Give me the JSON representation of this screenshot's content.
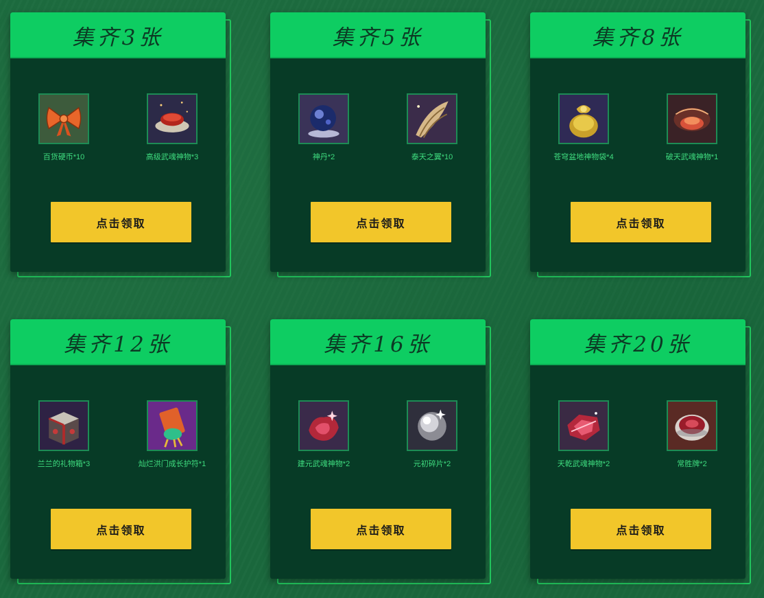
{
  "button_label": "点击领取",
  "cards": [
    {
      "title": "集齐3张",
      "rewards": [
        {
          "label": "百货硬币*10",
          "icon": "bow-icon"
        },
        {
          "label": "高级武魂神物*3",
          "icon": "artifact-plate-icon"
        }
      ]
    },
    {
      "title": "集齐5张",
      "rewards": [
        {
          "label": "神丹*2",
          "icon": "pill-orb-icon"
        },
        {
          "label": "泰天之翼*10",
          "icon": "wing-icon"
        }
      ]
    },
    {
      "title": "集齐8张",
      "rewards": [
        {
          "label": "苍穹盆地神物袋*4",
          "icon": "gold-bag-icon"
        },
        {
          "label": "破天武魂神物*1",
          "icon": "fire-artifact-icon"
        }
      ]
    },
    {
      "title": "集齐12张",
      "rewards": [
        {
          "label": "兰兰的礼物箱*3",
          "icon": "gift-box-icon"
        },
        {
          "label": "灿烂洪门成长护符*1",
          "icon": "amulet-icon"
        }
      ]
    },
    {
      "title": "集齐16张",
      "rewards": [
        {
          "label": "建元武魂神物*2",
          "icon": "red-crystal-icon"
        },
        {
          "label": "元初碎片*2",
          "icon": "silver-orb-icon"
        }
      ]
    },
    {
      "title": "集齐20张",
      "rewards": [
        {
          "label": "天乾武魂神物*2",
          "icon": "ruby-gem-icon"
        },
        {
          "label": "常胜牌*2",
          "icon": "ring-token-icon"
        }
      ]
    }
  ]
}
